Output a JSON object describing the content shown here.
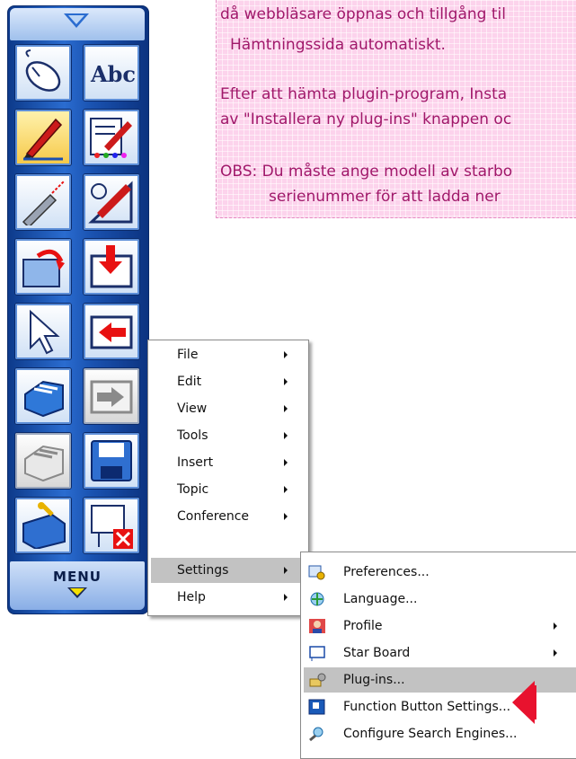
{
  "note": {
    "lines": [
      "då webbläsare öppnas och tillgång til",
      "Hämtningssida automatiskt.",
      "Efter att hämta plugin-program, Insta",
      "av \"Installera ny plug-ins\" knappen oc",
      "OBS: Du måste ange modell av starbo",
      "serienummer för att ladda ner"
    ]
  },
  "toolbar": {
    "menu_label": "MENU",
    "tools": [
      {
        "icon": "mouse-icon"
      },
      {
        "icon": "abc-text-icon",
        "text": "Abc"
      },
      {
        "icon": "pen-icon"
      },
      {
        "icon": "pen-settings-icon"
      },
      {
        "icon": "laser-pointer-icon"
      },
      {
        "icon": "ruler-pen-icon"
      },
      {
        "icon": "open-folder-icon"
      },
      {
        "icon": "import-icon"
      },
      {
        "icon": "cursor-arrow-icon"
      },
      {
        "icon": "back-arrow-icon"
      },
      {
        "icon": "pages-icon"
      },
      {
        "icon": "forward-arrow-icon"
      },
      {
        "icon": "gray-pages-icon"
      },
      {
        "icon": "save-disk-icon"
      },
      {
        "icon": "toolbox-icon"
      },
      {
        "icon": "close-board-icon"
      }
    ]
  },
  "main_menu": {
    "items": [
      {
        "label": "File",
        "submenu": true
      },
      {
        "label": "Edit",
        "submenu": true
      },
      {
        "label": "View",
        "submenu": true
      },
      {
        "label": "Tools",
        "submenu": true
      },
      {
        "label": "Insert",
        "submenu": true
      },
      {
        "label": "Topic",
        "submenu": true
      },
      {
        "label": "Conference",
        "submenu": true
      },
      {
        "label": "Settings",
        "submenu": true,
        "highlighted": true
      },
      {
        "label": "Help",
        "submenu": true
      }
    ]
  },
  "settings_menu": {
    "items": [
      {
        "label": "Preferences...",
        "icon": "preferences-icon",
        "submenu": false
      },
      {
        "label": "Language...",
        "icon": "language-icon",
        "submenu": false
      },
      {
        "label": "Profile",
        "icon": "profile-icon",
        "submenu": true
      },
      {
        "label": "Star Board",
        "icon": "starboard-icon",
        "submenu": true
      },
      {
        "label": "Plug-ins...",
        "icon": "plugins-icon",
        "submenu": false,
        "highlighted": true
      },
      {
        "label": "Function Button Settings...",
        "icon": "function-button-icon",
        "submenu": false
      },
      {
        "label": "Configure Search Engines...",
        "icon": "search-engines-icon",
        "submenu": false
      }
    ]
  },
  "colors": {
    "highlight": "#c2c2c2",
    "pointer": "#e8122e",
    "note_text": "#a0186a",
    "note_bg": "#fcd3ec"
  }
}
